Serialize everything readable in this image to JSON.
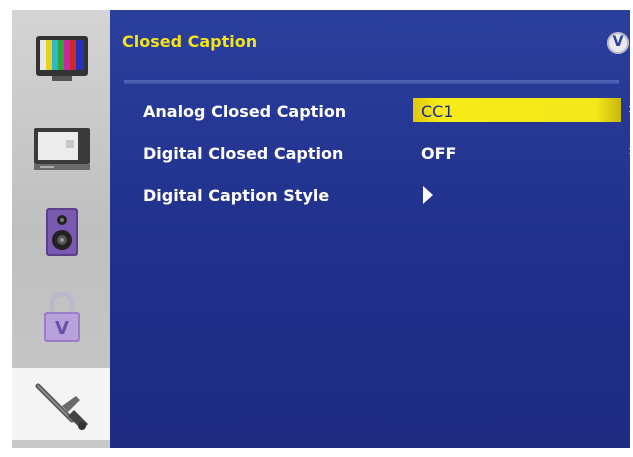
{
  "panel": {
    "title": "Closed Caption",
    "logo_letter": "V"
  },
  "menu": {
    "rows": [
      {
        "label": "Analog Closed Caption",
        "value": "CC1",
        "highlighted": true
      },
      {
        "label": "Digital Closed Caption",
        "value": "OFF",
        "highlighted": false
      },
      {
        "label": "Digital Caption Style",
        "value": "",
        "highlighted": false
      }
    ]
  },
  "rail": {
    "items": [
      {
        "icon": "picture-icon"
      },
      {
        "icon": "tv-input-icon"
      },
      {
        "icon": "speaker-icon"
      },
      {
        "icon": "lock-icon"
      },
      {
        "icon": "setup-wrench-icon",
        "selected": true
      }
    ]
  },
  "colors": {
    "panel_blue": "#1f2f8a",
    "title_yellow": "#f2e21a",
    "highlight_yellow": "#f4e81a"
  }
}
